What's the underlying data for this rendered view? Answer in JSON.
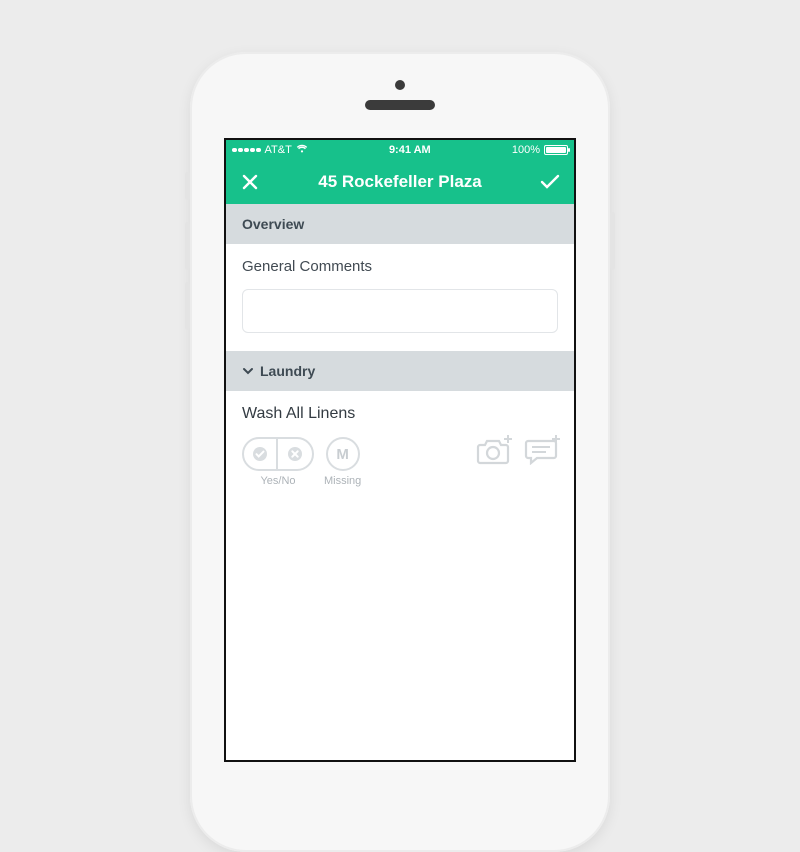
{
  "status_bar": {
    "carrier": "AT&T",
    "time": "9:41 AM",
    "battery_percent": "100%"
  },
  "header": {
    "title": "45 Rockefeller Plaza"
  },
  "sections": {
    "overview": {
      "label": "Overview",
      "general_comments_label": "General Comments",
      "general_comments_value": ""
    },
    "laundry": {
      "label": "Laundry",
      "task1": {
        "title": "Wash All Linens",
        "yesno_label": "Yes/No",
        "missing_label": "Missing",
        "missing_badge": "M"
      }
    }
  }
}
